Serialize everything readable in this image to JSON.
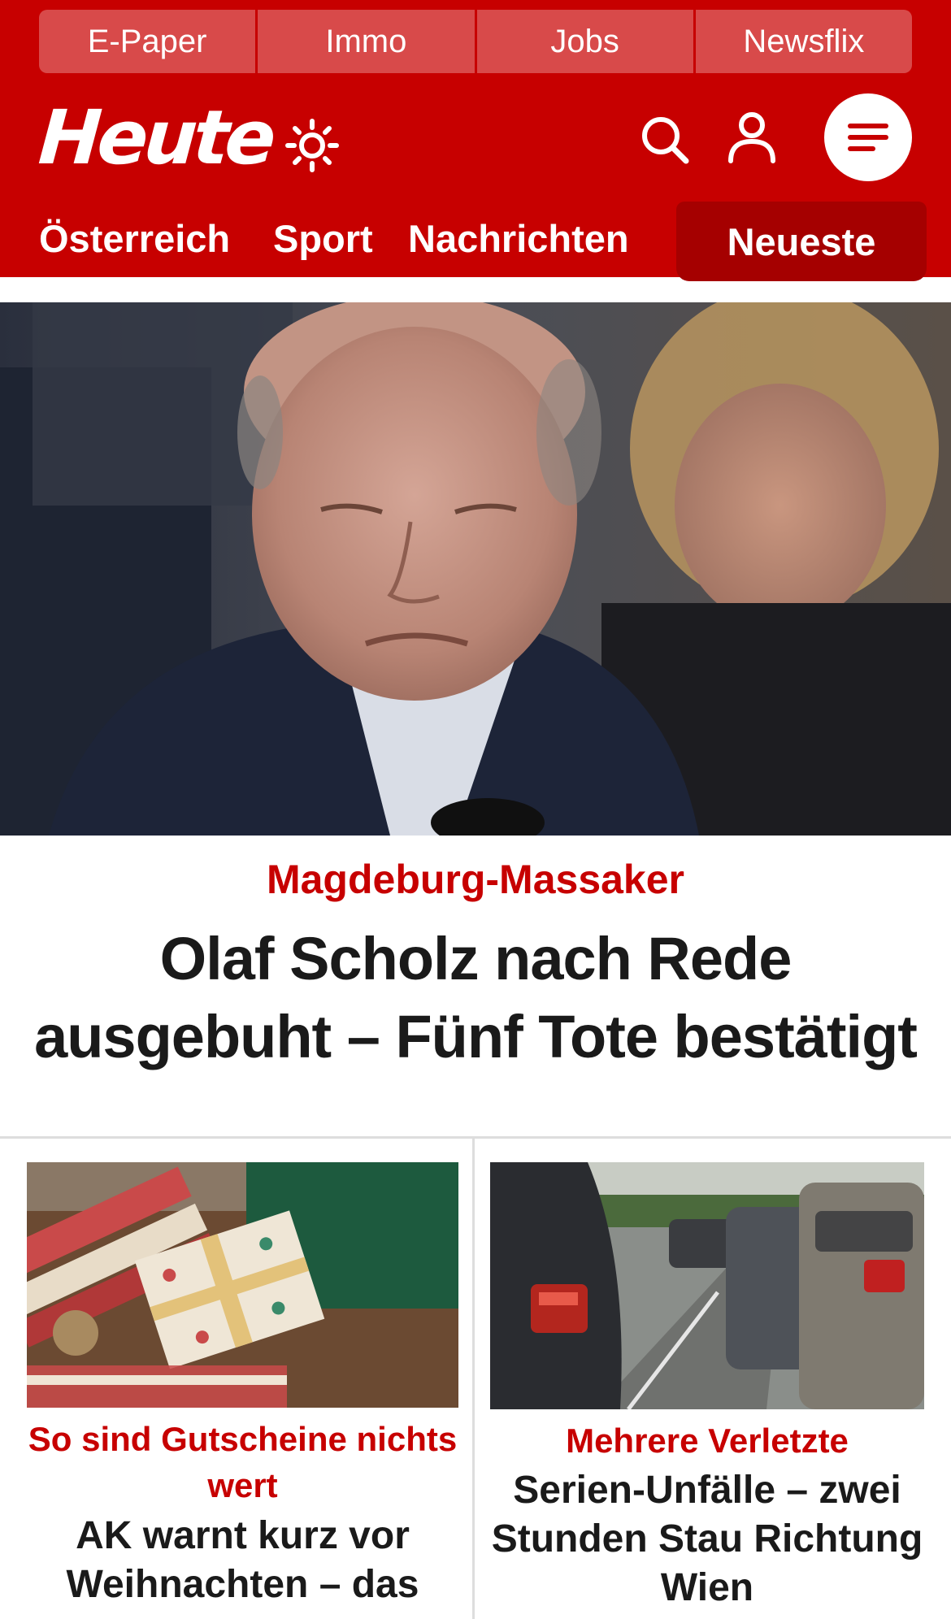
{
  "top_tabs": [
    "E-Paper",
    "Immo",
    "Jobs",
    "Newsflix"
  ],
  "brand": {
    "logo_text": "Heute"
  },
  "nav": {
    "items": [
      "Österreich",
      "Sport",
      "Nachrichten"
    ],
    "active_label": "Neueste"
  },
  "hero": {
    "kicker": "Magdeburg-Massaker",
    "title": "Olaf Scholz nach Rede ausgebuht – Fünf Tote bestätigt"
  },
  "teasers": [
    {
      "kicker": "So sind Gutscheine nichts wert",
      "title": "AK warnt kurz vor Weihnachten – das"
    },
    {
      "kicker": "Mehrere Verletzte",
      "title": "Serien-Unfälle – zwei Stunden Stau Richtung Wien"
    }
  ],
  "colors": {
    "brand_red": "#c70000",
    "tab_bg": "#d84a4a",
    "active_nav_bg": "#a50000",
    "text_dark": "#1a1a1a"
  },
  "icons": [
    "sun-icon",
    "search-icon",
    "user-icon",
    "menu-icon"
  ]
}
